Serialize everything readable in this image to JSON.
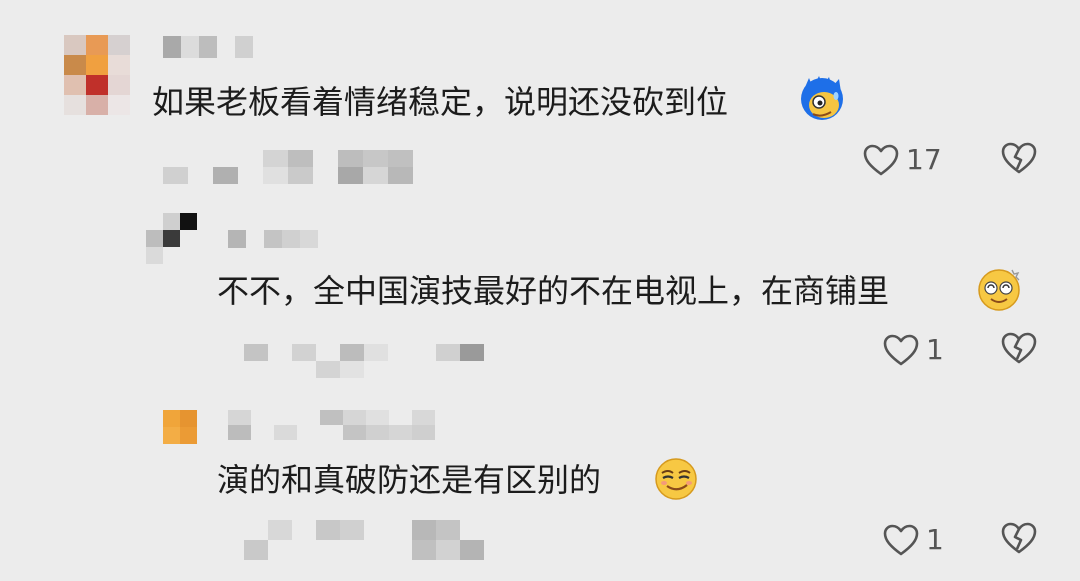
{
  "comments": [
    {
      "text": "如果老板看着情绪稳定，说明还没砍到位",
      "emoji": "sweating-blue-face-icon",
      "likes": "17"
    },
    {
      "text": "不不，全中国演技最好的不在电视上，在商铺里",
      "emoji": "dizzy-face-icon",
      "likes": "1"
    },
    {
      "text": "演的和真破防还是有区别的",
      "emoji": "smirking-face-icon",
      "likes": "1"
    }
  ],
  "colors": {
    "background": "#ececec",
    "text": "#1c1c1c",
    "icon": "#555555"
  }
}
